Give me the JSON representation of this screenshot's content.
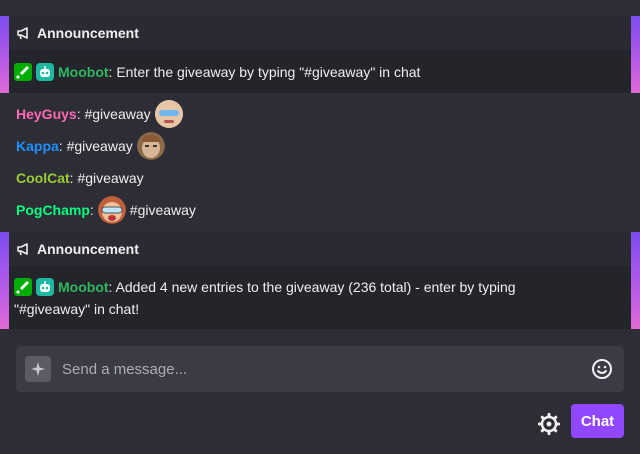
{
  "announcements": [
    {
      "header": "Announcement",
      "user": "Moobot",
      "user_color": "#2fb65f",
      "message": "Enter the giveaway by typing \"#giveaway\" in chat"
    },
    {
      "header": "Announcement",
      "user": "Moobot",
      "user_color": "#2fb65f",
      "message_line1": "Added 4 new entries to the giveaway (236 total) - enter by typing",
      "message_line2": "\"#giveaway\" in chat!"
    }
  ],
  "messages": [
    {
      "user": "HeyGuys",
      "color": "#ff69b4",
      "text": "#giveaway",
      "emote": "HeyGuys"
    },
    {
      "user": "Kappa",
      "color": "#1e90ff",
      "text": "#giveaway",
      "emote": "Kappa"
    },
    {
      "user": "CoolCat",
      "color": "#9acd32",
      "text": "#giveaway"
    },
    {
      "user": "PogChamp",
      "color": "#00ff7f",
      "text": "#giveaway",
      "emote": "PogChamp"
    }
  ],
  "separator": ":",
  "input": {
    "placeholder": "Send a message..."
  },
  "chat_button": "Chat",
  "icons": {
    "announcement": "megaphone-icon",
    "moderator": "sword-icon",
    "bot": "robot-icon",
    "input_left": "sparkle-icon",
    "emote_picker": "smiley-icon",
    "settings": "gear-icon"
  },
  "colors": {
    "accent": "#9147ff",
    "announcement_border_top": "#7b4cf0",
    "announcement_border_bottom": "#e06ad6"
  }
}
